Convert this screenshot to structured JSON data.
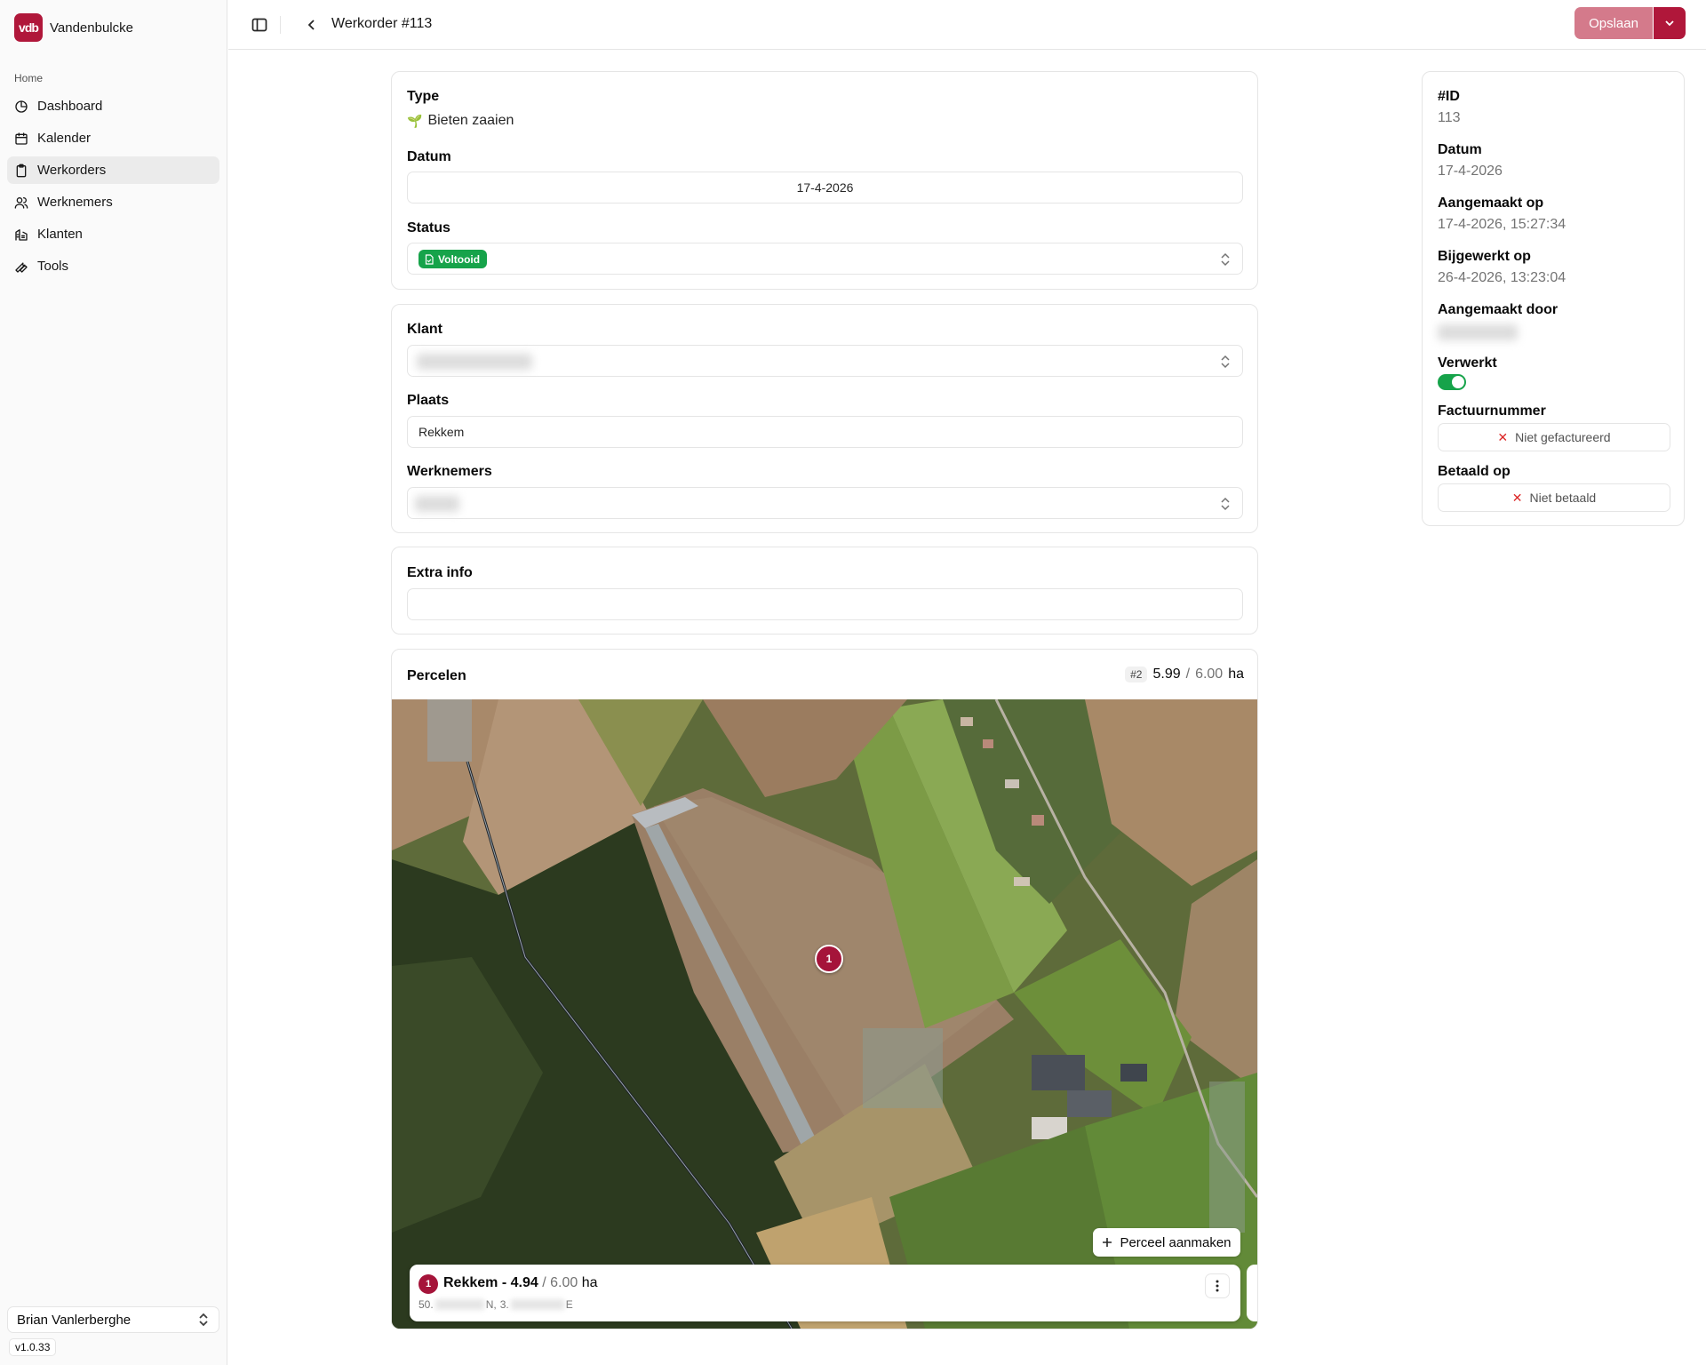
{
  "brand": {
    "name": "Vandenbulcke",
    "logo_text": "vdb",
    "color": "#b0173a"
  },
  "sidebar": {
    "group_label": "Home",
    "items": [
      {
        "label": "Dashboard",
        "icon": "dashboard-icon"
      },
      {
        "label": "Kalender",
        "icon": "calendar-icon"
      },
      {
        "label": "Werkorders",
        "icon": "clipboard-icon",
        "active": true
      },
      {
        "label": "Werknemers",
        "icon": "users-icon"
      },
      {
        "label": "Klanten",
        "icon": "building-icon"
      },
      {
        "label": "Tools",
        "icon": "wrench-icon"
      }
    ],
    "user": "Brian Vanlerberghe",
    "version": "v1.0.33"
  },
  "header": {
    "title": "Werkorder #113",
    "save_label": "Opslaan"
  },
  "form": {
    "type_label": "Type",
    "type_value": "Bieten zaaien",
    "type_emoji": "🌱",
    "date_label": "Datum",
    "date_value": "17-4-2026",
    "status_label": "Status",
    "status_value": "Voltooid",
    "status_color": "#16a34a",
    "client_label": "Klant",
    "place_label": "Plaats",
    "place_value": "Rekkem",
    "workers_label": "Werknemers",
    "extra_label": "Extra info",
    "extra_value": ""
  },
  "percelen": {
    "title": "Percelen",
    "count_badge": "#2",
    "area_done": "5.99",
    "area_sep": "/",
    "area_total": "6.00",
    "unit": "ha",
    "create_label": "Perceel aanmaken",
    "marker_number": "1",
    "parcel": {
      "number": "1",
      "name": "Rekkem",
      "dash": "-",
      "area": "4.94",
      "sep": "/",
      "total": "6.00",
      "unit": "ha",
      "lat_prefix": "50.",
      "lat_suffix": "N,",
      "lon_prefix": "3.",
      "lon_suffix": "E"
    }
  },
  "meta": {
    "id_label": "#ID",
    "id_value": "113",
    "date_label": "Datum",
    "date_value": "17-4-2026",
    "created_label": "Aangemaakt op",
    "created_value": "17-4-2026, 15:27:34",
    "updated_label": "Bijgewerkt op",
    "updated_value": "26-4-2026, 13:23:04",
    "created_by_label": "Aangemaakt door",
    "processed_label": "Verwerkt",
    "processed": true,
    "invoice_label": "Factuurnummer",
    "invoice_value": "Niet gefactureerd",
    "paid_label": "Betaald op",
    "paid_value": "Niet betaald"
  }
}
